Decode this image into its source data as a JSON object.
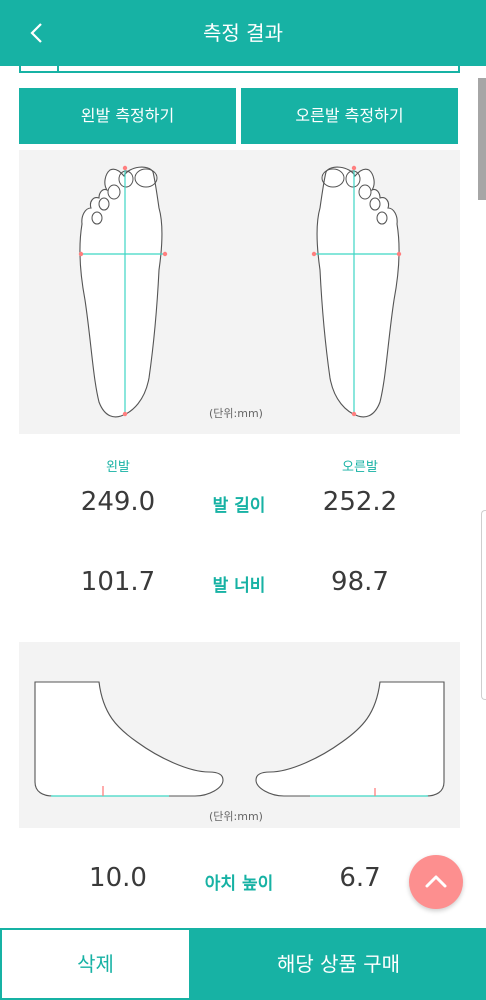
{
  "header": {
    "title": "측정 결과",
    "back_icon": "chevron-left-icon"
  },
  "measure_buttons": {
    "left": "왼발 측정하기",
    "right": "오른발 측정하기"
  },
  "sole_panel": {
    "unit": "(단위:mm)"
  },
  "results": {
    "left_label": "왼발",
    "right_label": "오른발",
    "rows": [
      {
        "label": "발 길이",
        "left": "249.0",
        "right": "252.2"
      },
      {
        "label": "발 너비",
        "left": "101.7",
        "right": "98.7"
      }
    ]
  },
  "side_panel": {
    "unit": "(단위:mm)"
  },
  "arch": {
    "label": "아치 높이",
    "left": "10.0",
    "right": "6.7"
  },
  "fab": {
    "icon": "chevron-up-icon"
  },
  "bottom": {
    "delete": "삭제",
    "buy": "해당 상품 구매"
  },
  "colors": {
    "primary": "#17b2a4",
    "fab": "#fd8f8f",
    "text": "#3a3a3a",
    "panel": "#f3f3f3"
  }
}
